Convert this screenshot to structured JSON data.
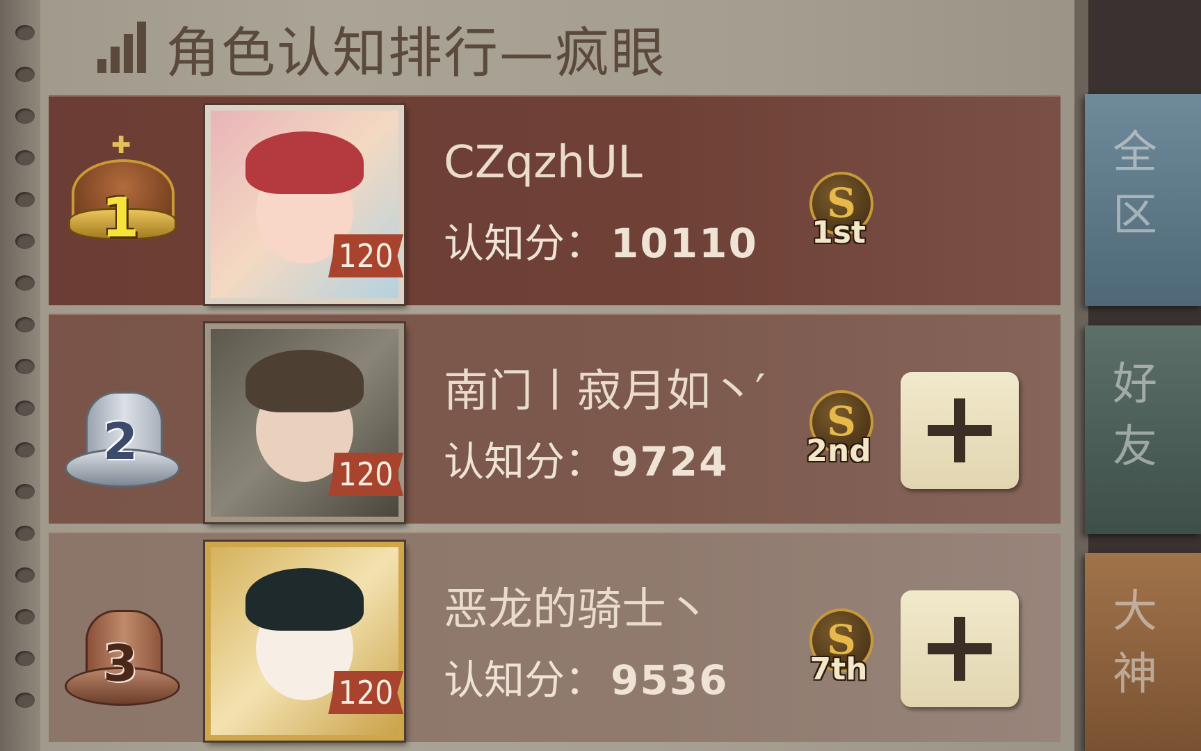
{
  "header": {
    "title": "角色认知排行—疯眼",
    "icon": "rank-bars-icon"
  },
  "score_label": "认知分：",
  "rankings": [
    {
      "rank": "1",
      "badge": "gold-crown",
      "name": "CZqzhUL",
      "level": "120",
      "score": "10110",
      "tier_letter": "S",
      "tier_rank": "1st",
      "can_add_friend": false
    },
    {
      "rank": "2",
      "badge": "silver-top-hat",
      "name": "南门丨寂月如丶′",
      "level": "120",
      "score": "9724",
      "tier_letter": "S",
      "tier_rank": "2nd",
      "can_add_friend": true
    },
    {
      "rank": "3",
      "badge": "bronze-fedora",
      "name": "恶龙的骑士丶",
      "level": "120",
      "score": "9536",
      "tier_letter": "S",
      "tier_rank": "7th",
      "can_add_friend": true
    }
  ],
  "add_friend_icon": "plus-icon",
  "tabs": [
    {
      "label": "全区"
    },
    {
      "label": "好友"
    },
    {
      "label": "大神"
    }
  ],
  "colors": {
    "paper": "#a8a294",
    "title": "#5b4a3c",
    "row1": "#6b3d34",
    "row2": "#7a5448",
    "row3": "#8c7569",
    "level_tag": "#a8432e",
    "tier_gold": "#c69a3c"
  }
}
